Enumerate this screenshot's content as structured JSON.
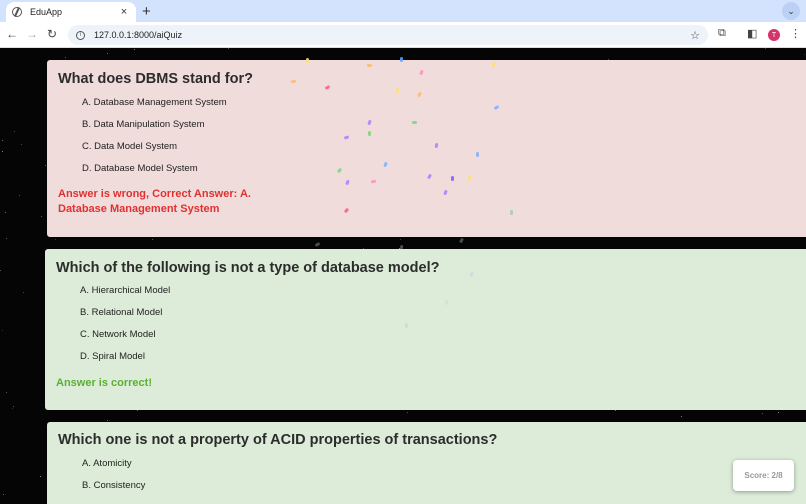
{
  "browser": {
    "tab_title": "EduApp",
    "tab_close": "×",
    "new_tab": "+",
    "url": "127.0.0.1:8000/aiQuiz",
    "avatar_letter": "T"
  },
  "questions": [
    {
      "text": "What does DBMS stand for?",
      "options": [
        "A. Database Management System",
        "B. Data Manipulation System",
        "C. Data Model System",
        "D. Database Model System"
      ],
      "result": "Answer is wrong, Correct Answer: A. Database Management System",
      "result_line1": "Answer is wrong, Correct Answer: A.",
      "result_line2": "Database Management System",
      "status": "wrong"
    },
    {
      "text": "Which of the following is not a type of database model?",
      "options": [
        "A. Hierarchical Model",
        "B. Relational Model",
        "C. Network Model",
        "D. Spiral Model"
      ],
      "result": "Answer is correct!",
      "status": "correct"
    },
    {
      "text": "Which one is not a property of ACID properties of transactions?",
      "options": [
        "A. Atomicity",
        "B. Consistency"
      ],
      "status": "correct"
    }
  ],
  "score": "Score: 2/8",
  "colors": {
    "wrong_bg": "#f1dcdc",
    "correct_bg": "#dcecd8",
    "wrong_text": "#e03131",
    "correct_text": "#5bb032"
  }
}
